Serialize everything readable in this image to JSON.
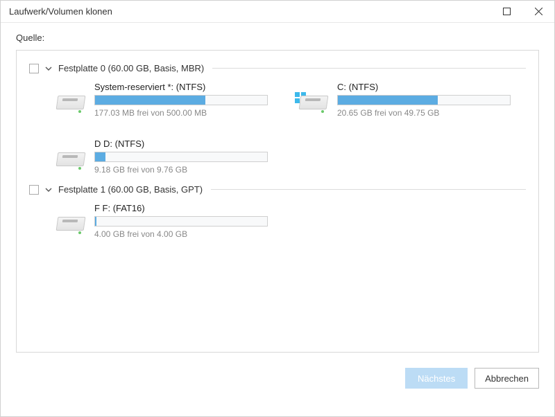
{
  "window": {
    "title": "Laufwerk/Volumen klonen"
  },
  "source_label": "Quelle:",
  "disks": [
    {
      "label": "Festplatte 0 (60.00 GB, Basis, MBR)",
      "partitions": [
        {
          "name": "System-reserviert *: (NTFS)",
          "free": "177.03 MB frei von 500.00 MB",
          "fill_pct": 64,
          "win_badge": false
        },
        {
          "name": "C: (NTFS)",
          "free": "20.65 GB frei von 49.75 GB",
          "fill_pct": 58,
          "win_badge": true
        },
        {
          "name": "D D: (NTFS)",
          "free": "9.18 GB frei von 9.76 GB",
          "fill_pct": 6,
          "win_badge": false
        }
      ]
    },
    {
      "label": "Festplatte 1 (60.00 GB, Basis, GPT)",
      "partitions": [
        {
          "name": "F F: (FAT16)",
          "free": "4.00 GB frei von 4.00 GB",
          "fill_pct": 1,
          "win_badge": false
        }
      ]
    }
  ],
  "buttons": {
    "next": "Nächstes",
    "cancel": "Abbrechen"
  }
}
